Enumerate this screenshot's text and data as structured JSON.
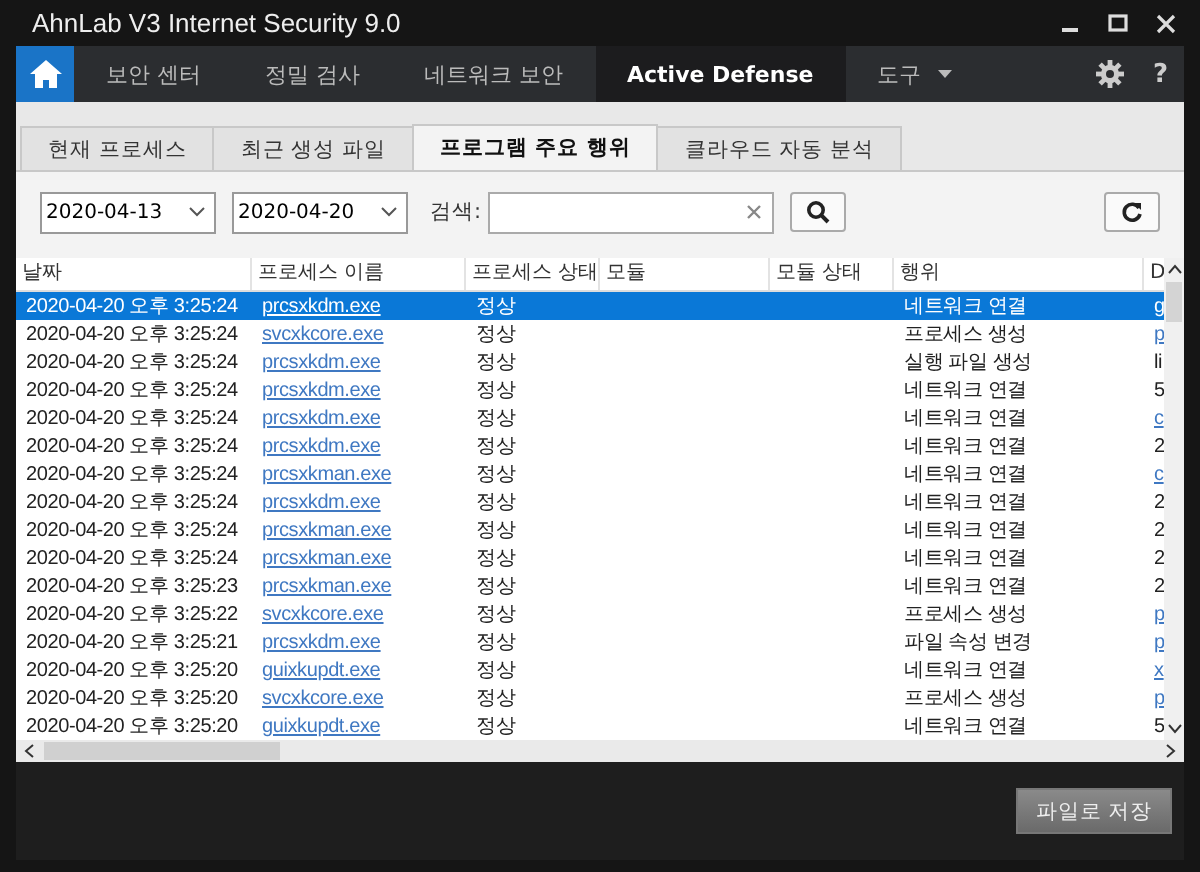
{
  "window": {
    "title": "AhnLab V3 Internet Security 9.0"
  },
  "nav": {
    "items": [
      {
        "label": "보안 센터",
        "selected": false,
        "dropdown": false
      },
      {
        "label": "정밀 검사",
        "selected": false,
        "dropdown": false
      },
      {
        "label": "네트워크 보안",
        "selected": false,
        "dropdown": false
      },
      {
        "label": "Active Defense",
        "selected": true,
        "dropdown": false
      },
      {
        "label": "도구",
        "selected": false,
        "dropdown": true
      }
    ],
    "help": "?"
  },
  "tabs": [
    {
      "label": "현재 프로세스",
      "selected": false
    },
    {
      "label": "최근 생성 파일",
      "selected": false
    },
    {
      "label": "프로그램 주요 행위",
      "selected": true
    },
    {
      "label": "클라우드 자동 분석",
      "selected": false
    }
  ],
  "filter": {
    "start_date": "2020-04-13",
    "end_date": "2020-04-20",
    "search_label": "검색:"
  },
  "table": {
    "columns": [
      "날짜",
      "프로세스 이름",
      "프로세스 상태",
      "모듈",
      "모듈 상태",
      "행위",
      "D"
    ],
    "rows": [
      {
        "date": "2020-04-20 오후 3:25:24",
        "process": "prcsxkdm.exe",
        "status": "정상",
        "action": "네트워크 연결",
        "column_7": "g",
        "column_7_link": true,
        "selected": true
      },
      {
        "date": "2020-04-20 오후 3:25:24",
        "process": "svcxkcore.exe",
        "status": "정상",
        "action": "프로세스 생성",
        "column_7": "p",
        "column_7_link": true,
        "selected": false
      },
      {
        "date": "2020-04-20 오후 3:25:24",
        "process": "prcsxkdm.exe",
        "status": "정상",
        "action": "실행 파일 생성",
        "column_7": "li",
        "column_7_link": false,
        "selected": false
      },
      {
        "date": "2020-04-20 오후 3:25:24",
        "process": "prcsxkdm.exe",
        "status": "정상",
        "action": "네트워크 연결",
        "column_7": "5",
        "column_7_link": false,
        "selected": false
      },
      {
        "date": "2020-04-20 오후 3:25:24",
        "process": "prcsxkdm.exe",
        "status": "정상",
        "action": "네트워크 연결",
        "column_7": "c",
        "column_7_link": true,
        "selected": false
      },
      {
        "date": "2020-04-20 오후 3:25:24",
        "process": "prcsxkdm.exe",
        "status": "정상",
        "action": "네트워크 연결",
        "column_7": "2",
        "column_7_link": false,
        "selected": false
      },
      {
        "date": "2020-04-20 오후 3:25:24",
        "process": "prcsxkman.exe",
        "status": "정상",
        "action": "네트워크 연결",
        "column_7": "c",
        "column_7_link": true,
        "selected": false
      },
      {
        "date": "2020-04-20 오후 3:25:24",
        "process": "prcsxkdm.exe",
        "status": "정상",
        "action": "네트워크 연결",
        "column_7": "2",
        "column_7_link": false,
        "selected": false
      },
      {
        "date": "2020-04-20 오후 3:25:24",
        "process": "prcsxkman.exe",
        "status": "정상",
        "action": "네트워크 연결",
        "column_7": "2",
        "column_7_link": false,
        "selected": false
      },
      {
        "date": "2020-04-20 오후 3:25:24",
        "process": "prcsxkman.exe",
        "status": "정상",
        "action": "네트워크 연결",
        "column_7": "2",
        "column_7_link": false,
        "selected": false
      },
      {
        "date": "2020-04-20 오후 3:25:23",
        "process": "prcsxkman.exe",
        "status": "정상",
        "action": "네트워크 연결",
        "column_7": "2",
        "column_7_link": false,
        "selected": false
      },
      {
        "date": "2020-04-20 오후 3:25:22",
        "process": "svcxkcore.exe",
        "status": "정상",
        "action": "프로세스 생성",
        "column_7": "p",
        "column_7_link": true,
        "selected": false
      },
      {
        "date": "2020-04-20 오후 3:25:21",
        "process": "prcsxkdm.exe",
        "status": "정상",
        "action": "파일 속성 변경",
        "column_7": "p",
        "column_7_link": true,
        "selected": false
      },
      {
        "date": "2020-04-20 오후 3:25:20",
        "process": "guixkupdt.exe",
        "status": "정상",
        "action": "네트워크 연결",
        "column_7": "x",
        "column_7_link": true,
        "selected": false
      },
      {
        "date": "2020-04-20 오후 3:25:20",
        "process": "svcxkcore.exe",
        "status": "정상",
        "action": "프로세스 생성",
        "column_7": "p",
        "column_7_link": true,
        "selected": false
      },
      {
        "date": "2020-04-20 오후 3:25:20",
        "process": "guixkupdt.exe",
        "status": "정상",
        "action": "네트워크 연결",
        "column_7": "5",
        "column_7_link": false,
        "selected": false
      }
    ]
  },
  "save_button": "파일로 저장"
}
